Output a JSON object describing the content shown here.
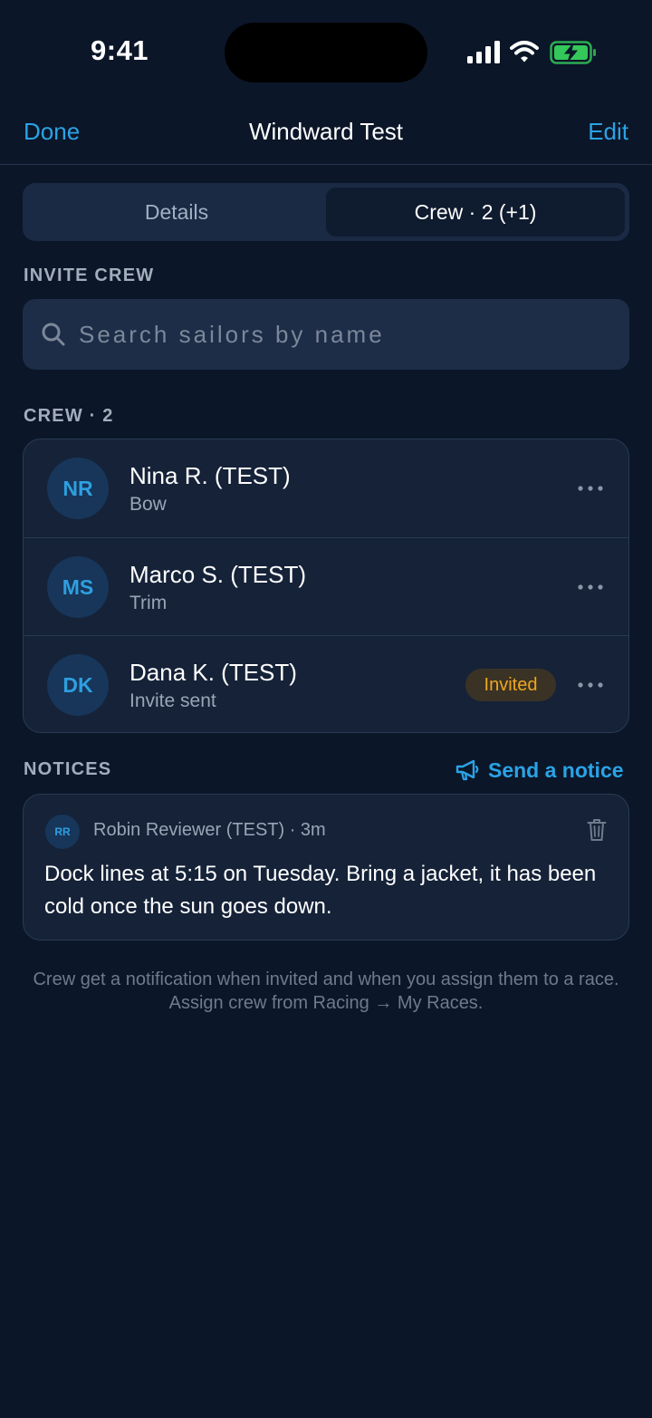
{
  "status_bar": {
    "time": "9:41"
  },
  "nav": {
    "left_button": "Done",
    "title": "Windward Test",
    "right_button": "Edit"
  },
  "segmented": {
    "details_label": "Details",
    "crew_label": "Crew · 2 (+1)",
    "selected": "crew"
  },
  "invite": {
    "section_label": "INVITE CREW",
    "placeholder": "Search sailors by name"
  },
  "crew": {
    "section_label": "CREW · 2",
    "members": [
      {
        "initials": "NR",
        "name": "Nina R. (TEST)",
        "role": "Bow"
      },
      {
        "initials": "MS",
        "name": "Marco S. (TEST)",
        "role": "Trim"
      },
      {
        "initials": "DK",
        "name": "Dana K. (TEST)",
        "role": "Invite sent",
        "badge": "Invited"
      }
    ]
  },
  "notices": {
    "section_label": "NOTICES",
    "send_label": "Send a notice",
    "items": [
      {
        "author_initials": "RR",
        "meta": "Robin Reviewer (TEST) · 3m",
        "body": "Dock lines at 5:15 on Tuesday. Bring a jacket, it has been cold once the sun goes down."
      }
    ]
  },
  "footer_note": "Crew get a notification when invited and when you assign them to a race. Assign crew from Racing → My Races.",
  "colors": {
    "accent": "#2aa3e6",
    "background": "#0b1628",
    "card": "#152238",
    "badge_text": "#f0a61e",
    "battery": "#34c759"
  },
  "icons": [
    "signal-icon",
    "wifi-icon",
    "battery-charging-icon",
    "search-icon",
    "more-icon",
    "megaphone-icon",
    "trash-icon"
  ]
}
